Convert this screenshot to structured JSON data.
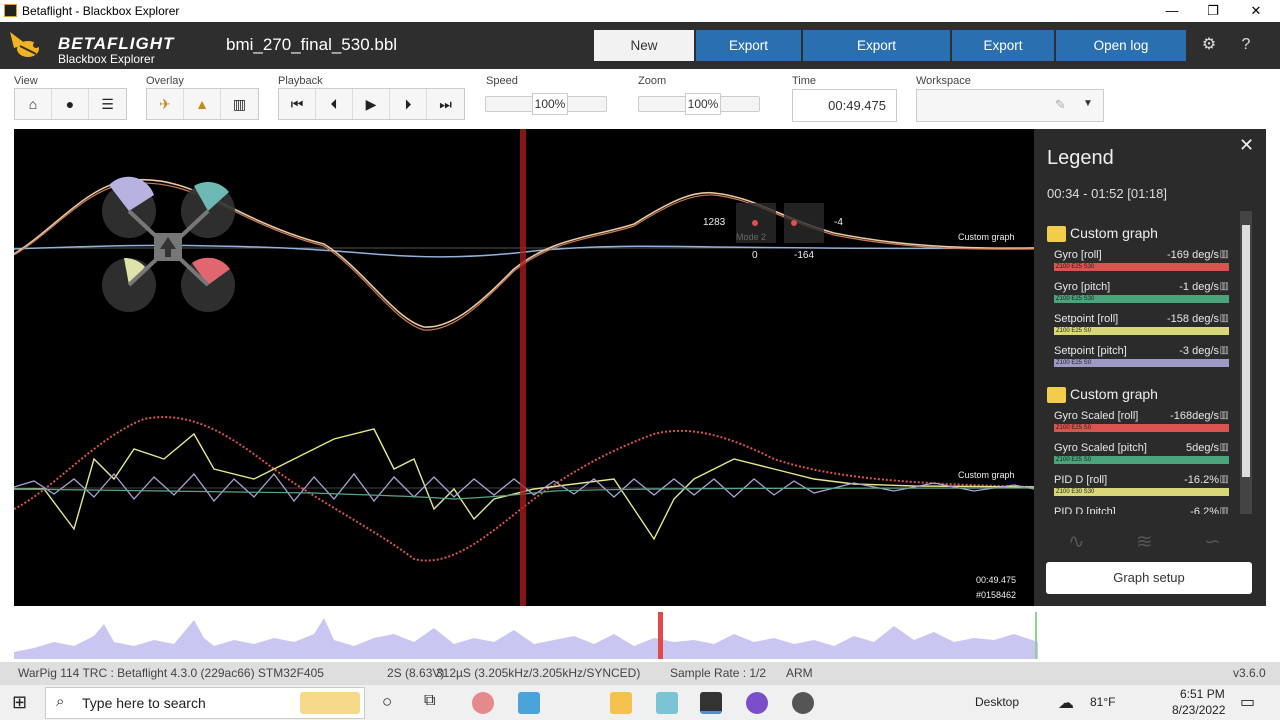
{
  "window": {
    "title": "Betaflight - Blackbox Explorer",
    "minimize": "—",
    "restore": "❐",
    "close": "✕"
  },
  "header": {
    "brand": "BETAFLIGHT",
    "brand_sub": "Blackbox Explorer",
    "log_title": "bmi_270_final_530.bbl",
    "buttons": {
      "new_window": "New Window",
      "export_video": "Export video...",
      "export_workspaces": "Export Workspaces...",
      "export_csv": "Export CSV...",
      "open_log": "Open log file/video"
    }
  },
  "toolbar": {
    "labels": {
      "view": "View",
      "overlay": "Overlay",
      "playback": "Playback",
      "speed": "Speed",
      "zoom": "Zoom",
      "time": "Time",
      "workspace": "Workspace"
    },
    "speed": "100%",
    "zoom": "100%",
    "time": "00:49.475"
  },
  "graph": {
    "stick_values": {
      "left_top": "1283",
      "right_top": "-4",
      "left_bottom": "0",
      "right_bottom": "-164"
    },
    "mode_label": "Mode 2",
    "graph_label_1": "Custom graph",
    "graph_label_2": "Custom graph",
    "time": "00:49.475",
    "frame": "#0158462"
  },
  "legend": {
    "title": "Legend",
    "range": "00:34 - 01:52 [01:18]",
    "groups": [
      {
        "name": "Custom graph",
        "items": [
          {
            "name": "Gyro [roll]",
            "value": "-169 deg/s",
            "color": "#d9534f",
            "tag": "Z100 E25 S30"
          },
          {
            "name": "Gyro [pitch]",
            "value": "-1 deg/s",
            "color": "#4aa37a",
            "tag": "Z100 E25 S30"
          },
          {
            "name": "Setpoint [roll]",
            "value": "-158 deg/s",
            "color": "#d8d87a",
            "tag": "Z100 E25 S0"
          },
          {
            "name": "Setpoint [pitch]",
            "value": "-3 deg/s",
            "color": "#9d98c4",
            "tag": "Z100 E25 S0"
          }
        ]
      },
      {
        "name": "Custom graph",
        "items": [
          {
            "name": "Gyro Scaled [roll]",
            "value": "-168deg/s",
            "color": "#d9534f",
            "tag": "Z100 E25 S0"
          },
          {
            "name": "Gyro Scaled [pitch]",
            "value": "5deg/s",
            "color": "#4aa37a",
            "tag": "Z100 E25 S0"
          },
          {
            "name": "PID D [roll]",
            "value": "-16.2%",
            "color": "#d8d87a",
            "tag": "Z100 E30 S30"
          },
          {
            "name": "PID D [pitch]",
            "value": "-6.2%",
            "color": "#9d98c4",
            "tag": ""
          }
        ]
      }
    ],
    "graph_setup": "Graph setup"
  },
  "status": {
    "craft": "WarPig 114 TRC : Betaflight 4.3.0 (229ac66) STM32F405",
    "battery": "2S (8.63V)",
    "looptime": "312µS (3.205kHz/3.205kHz/SYNCED)",
    "sample_rate": "Sample Rate : 1/2",
    "arm": "ARM",
    "version": "v3.6.0"
  },
  "taskbar": {
    "search_placeholder": "Type here to search",
    "desktop": "Desktop",
    "temperature": "81°F",
    "clock_time": "6:51 PM",
    "clock_date": "8/23/2022"
  }
}
